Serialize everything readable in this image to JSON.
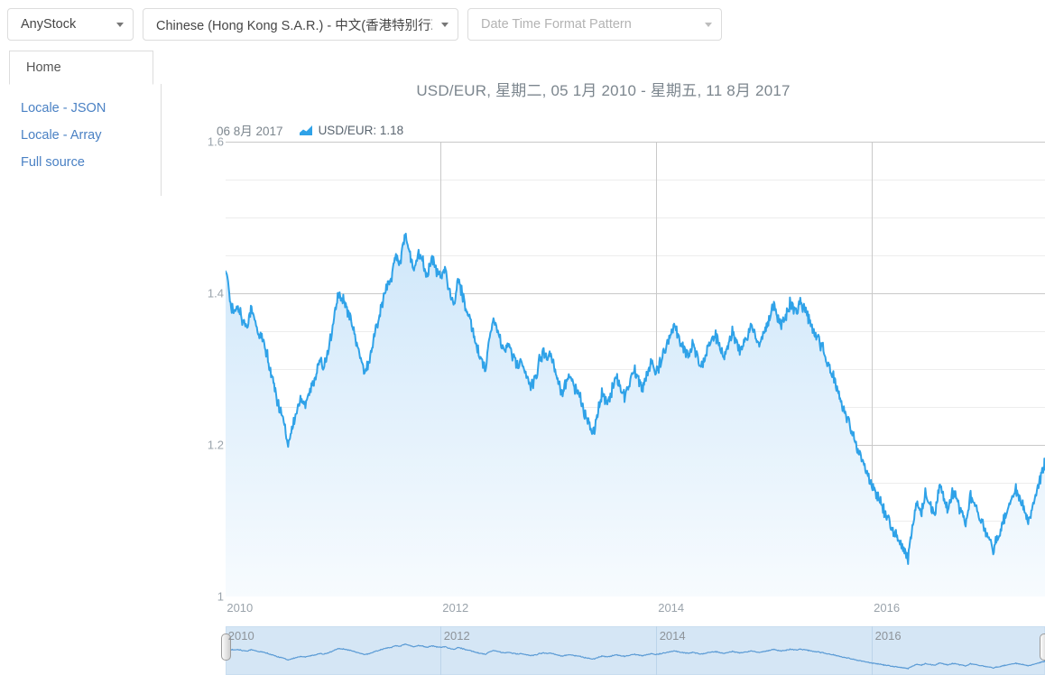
{
  "toolbar": {
    "product_select": {
      "value": "AnyStock",
      "icon": "chevron-down-icon"
    },
    "locale_select": {
      "value": "Chinese (Hong Kong S.A.R.) - 中文(香港特别行政[",
      "icon": "chevron-down-icon"
    },
    "pattern_select": {
      "placeholder": "Date Time Format Pattern",
      "value": "",
      "icon": "chevron-down-icon"
    }
  },
  "tabs": [
    {
      "label": "Home",
      "active": true
    }
  ],
  "sidebar": {
    "items": [
      {
        "label": "Locale - JSON"
      },
      {
        "label": "Locale - Array"
      },
      {
        "label": "Full source"
      }
    ]
  },
  "legend": {
    "date": "06 8月 2017",
    "icon": "area-series-icon",
    "series_text": "USD/EUR: 1.18"
  },
  "colors": {
    "line": "#2fa2e8",
    "area_top": "#cfe7fa",
    "area_bottom": "#f4fafe",
    "grid_major": "#c9c9c9",
    "grid_minor": "#ededed",
    "axis_text": "#9aa3ab",
    "title_text": "#7c868e",
    "link": "#4a81c4",
    "scroller_bg": "#d5e6f5"
  },
  "chart_data": {
    "type": "area",
    "title": "USD/EUR, 星期二, 05 1月 2010 - 星期五, 11 8月 2017",
    "xlabel": "",
    "ylabel": "",
    "ylim": [
      1.0,
      1.6
    ],
    "y_ticks": [
      "1",
      "1.2",
      "1.4",
      "1.6"
    ],
    "y_tick_values": [
      1.0,
      1.2,
      1.4,
      1.6
    ],
    "y_minor_step": 0.05,
    "x_ticks": [
      "2010",
      "2012",
      "2014",
      "2016"
    ],
    "x_tick_values": [
      2010,
      2012,
      2014,
      2016
    ],
    "xlim": [
      2010.01,
      2017.61
    ],
    "grid": true,
    "legend_position": "top-left",
    "series": [
      {
        "name": "USD/EUR",
        "x": [
          2010.01,
          2010.05,
          2010.09,
          2010.13,
          2010.17,
          2010.21,
          2010.25,
          2010.3,
          2010.34,
          2010.38,
          2010.42,
          2010.46,
          2010.5,
          2010.55,
          2010.59,
          2010.63,
          2010.67,
          2010.71,
          2010.75,
          2010.8,
          2010.84,
          2010.88,
          2010.92,
          2010.96,
          2011.01,
          2011.05,
          2011.09,
          2011.13,
          2011.17,
          2011.21,
          2011.25,
          2011.3,
          2011.34,
          2011.38,
          2011.42,
          2011.46,
          2011.5,
          2011.55,
          2011.59,
          2011.63,
          2011.67,
          2011.71,
          2011.75,
          2011.8,
          2011.84,
          2011.88,
          2011.92,
          2011.96,
          2012.01,
          2012.05,
          2012.09,
          2012.13,
          2012.17,
          2012.21,
          2012.25,
          2012.3,
          2012.34,
          2012.38,
          2012.42,
          2012.46,
          2012.5,
          2012.55,
          2012.59,
          2012.63,
          2012.67,
          2012.71,
          2012.75,
          2012.8,
          2012.84,
          2012.88,
          2012.92,
          2012.96,
          2013.01,
          2013.05,
          2013.09,
          2013.13,
          2013.17,
          2013.21,
          2013.25,
          2013.3,
          2013.34,
          2013.38,
          2013.42,
          2013.46,
          2013.5,
          2013.55,
          2013.59,
          2013.63,
          2013.67,
          2013.71,
          2013.75,
          2013.8,
          2013.84,
          2013.88,
          2013.92,
          2013.96,
          2014.01,
          2014.05,
          2014.09,
          2014.13,
          2014.17,
          2014.21,
          2014.25,
          2014.3,
          2014.34,
          2014.38,
          2014.42,
          2014.46,
          2014.5,
          2014.55,
          2014.59,
          2014.63,
          2014.67,
          2014.71,
          2014.75,
          2014.8,
          2014.84,
          2014.88,
          2014.92,
          2014.96,
          2015.01,
          2015.05,
          2015.09,
          2015.13,
          2015.17,
          2015.21,
          2015.25,
          2015.3,
          2015.34,
          2015.38,
          2015.42,
          2015.46,
          2015.5,
          2015.55,
          2015.59,
          2015.63,
          2015.67,
          2015.71,
          2015.75,
          2015.8,
          2015.84,
          2015.88,
          2015.92,
          2015.96,
          2016.01,
          2016.05,
          2016.09,
          2016.13,
          2016.17,
          2016.21,
          2016.25,
          2016.3,
          2016.34,
          2016.38,
          2016.42,
          2016.46,
          2016.5,
          2016.55,
          2016.59,
          2016.63,
          2016.67,
          2016.71,
          2016.75,
          2016.8,
          2016.84,
          2016.88,
          2016.92,
          2016.96,
          2017.01,
          2017.05,
          2017.09,
          2017.13,
          2017.17,
          2017.21,
          2017.25,
          2017.3,
          2017.34,
          2017.38,
          2017.42,
          2017.46,
          2017.5,
          2017.55,
          2017.59,
          2017.61
        ],
        "y": [
          1.437,
          1.392,
          1.372,
          1.38,
          1.363,
          1.358,
          1.38,
          1.352,
          1.341,
          1.325,
          1.304,
          1.276,
          1.251,
          1.232,
          1.2,
          1.222,
          1.244,
          1.262,
          1.256,
          1.271,
          1.291,
          1.31,
          1.305,
          1.324,
          1.36,
          1.396,
          1.393,
          1.38,
          1.368,
          1.342,
          1.322,
          1.292,
          1.31,
          1.338,
          1.362,
          1.386,
          1.404,
          1.423,
          1.452,
          1.44,
          1.476,
          1.458,
          1.431,
          1.452,
          1.44,
          1.42,
          1.446,
          1.432,
          1.424,
          1.428,
          1.402,
          1.384,
          1.42,
          1.396,
          1.372,
          1.352,
          1.33,
          1.312,
          1.296,
          1.344,
          1.366,
          1.34,
          1.322,
          1.337,
          1.318,
          1.305,
          1.312,
          1.291,
          1.276,
          1.286,
          1.312,
          1.322,
          1.318,
          1.306,
          1.288,
          1.269,
          1.283,
          1.293,
          1.276,
          1.262,
          1.242,
          1.228,
          1.216,
          1.242,
          1.268,
          1.254,
          1.271,
          1.291,
          1.278,
          1.263,
          1.282,
          1.3,
          1.286,
          1.272,
          1.292,
          1.31,
          1.296,
          1.312,
          1.326,
          1.344,
          1.36,
          1.344,
          1.328,
          1.316,
          1.332,
          1.318,
          1.302,
          1.318,
          1.334,
          1.346,
          1.33,
          1.316,
          1.333,
          1.35,
          1.336,
          1.322,
          1.34,
          1.358,
          1.346,
          1.33,
          1.352,
          1.366,
          1.382,
          1.37,
          1.356,
          1.372,
          1.388,
          1.374,
          1.39,
          1.38,
          1.366,
          1.352,
          1.34,
          1.326,
          1.312,
          1.296,
          1.28,
          1.262,
          1.244,
          1.226,
          1.208,
          1.19,
          1.178,
          1.162,
          1.146,
          1.134,
          1.122,
          1.108,
          1.096,
          1.084,
          1.072,
          1.06,
          1.048,
          1.09,
          1.122,
          1.108,
          1.136,
          1.12,
          1.106,
          1.144,
          1.128,
          1.112,
          1.138,
          1.124,
          1.11,
          1.096,
          1.132,
          1.118,
          1.104,
          1.09,
          1.076,
          1.062,
          1.078,
          1.094,
          1.11,
          1.126,
          1.142,
          1.128,
          1.112,
          1.098,
          1.12,
          1.146,
          1.168,
          1.18
        ]
      }
    ]
  },
  "scroller": {
    "x_ticks": [
      "2010",
      "2012",
      "2014",
      "2016"
    ],
    "left_handle": "range-left-handle",
    "right_handle": "range-right-handle"
  }
}
